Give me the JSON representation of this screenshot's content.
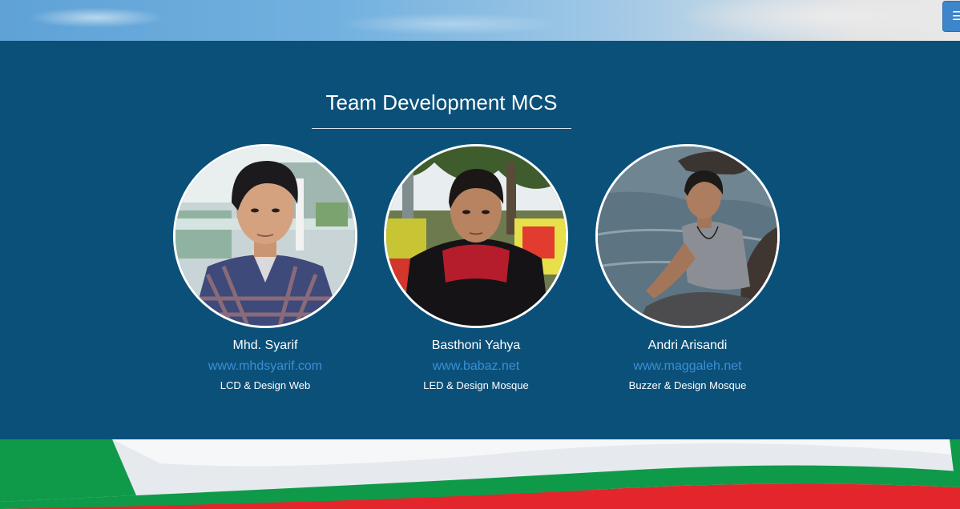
{
  "header": {
    "menu_icon": "hamburger-icon",
    "menu_glyph": "☰"
  },
  "team": {
    "title": "Team Development MCS",
    "members": [
      {
        "name": "Mhd. Syarif",
        "site": "www.mhdsyarif.com",
        "role": "LCD & Design Web"
      },
      {
        "name": "Basthoni Yahya",
        "site": "www.babaz.net",
        "role": "LED & Design Mosque"
      },
      {
        "name": "Andri Arisandi",
        "site": "www.maggaleh.net",
        "role": "Buzzer & Design Mosque"
      }
    ]
  },
  "colors": {
    "section_background": "#0b5079",
    "link": "#3b8fd6",
    "menu_button": "#3c86c9",
    "banner_green": "#0f9a4a",
    "banner_red": "#e3262b"
  }
}
